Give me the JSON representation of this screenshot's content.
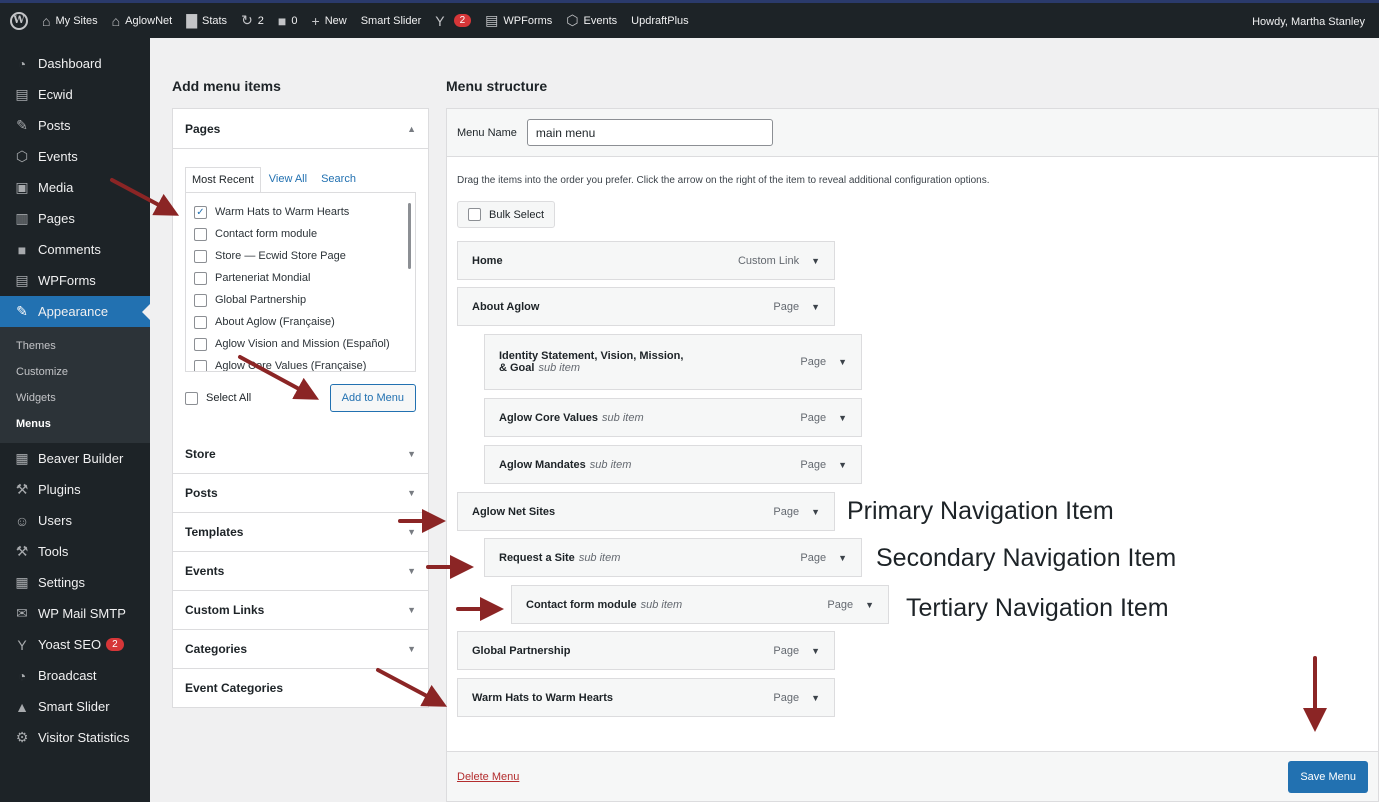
{
  "adminbar": {
    "items": [
      {
        "icon": "home-sites-icon",
        "glyph": "⌂",
        "label": "My Sites"
      },
      {
        "icon": "home-icon",
        "glyph": "⌂",
        "label": "AglowNet"
      },
      {
        "icon": "stats-icon",
        "glyph": "▇",
        "label": "Stats"
      },
      {
        "icon": "updates-icon",
        "glyph": "↻",
        "label": "2"
      },
      {
        "icon": "comment-icon",
        "glyph": "■",
        "label": "0"
      },
      {
        "icon": "plus-icon",
        "glyph": "+",
        "label": "New"
      },
      {
        "icon": "",
        "glyph": "",
        "label": "Smart Slider"
      },
      {
        "icon": "yoast-icon",
        "glyph": "Y",
        "label": ""
      },
      {
        "icon": "wpforms-icon",
        "glyph": "▤",
        "label": "WPForms"
      },
      {
        "icon": "events-icon",
        "glyph": "⬡",
        "label": "Events"
      },
      {
        "icon": "",
        "glyph": "",
        "label": "UpdraftPlus"
      }
    ],
    "yoast_badge": "2",
    "greeting": "Howdy, Martha Stanley"
  },
  "sidebar": {
    "items": [
      {
        "key": "dashboard",
        "label": "Dashboard",
        "glyph": "◔"
      },
      {
        "key": "ecwid",
        "label": "Ecwid",
        "glyph": "▤"
      },
      {
        "key": "posts",
        "label": "Posts",
        "glyph": "✎"
      },
      {
        "key": "events",
        "label": "Events",
        "glyph": "⬡"
      },
      {
        "key": "media",
        "label": "Media",
        "glyph": "▣"
      },
      {
        "key": "pages",
        "label": "Pages",
        "glyph": "▥"
      },
      {
        "key": "comments",
        "label": "Comments",
        "glyph": "■"
      },
      {
        "key": "wpforms",
        "label": "WPForms",
        "glyph": "▤"
      },
      {
        "key": "appearance",
        "label": "Appearance",
        "glyph": "✎"
      }
    ],
    "submenu": [
      "Themes",
      "Customize",
      "Widgets",
      "Menus"
    ],
    "items2": [
      {
        "key": "beaver-builder",
        "label": "Beaver Builder",
        "glyph": "▦"
      },
      {
        "key": "plugins",
        "label": "Plugins",
        "glyph": "⚒"
      },
      {
        "key": "users",
        "label": "Users",
        "glyph": "☺"
      },
      {
        "key": "tools",
        "label": "Tools",
        "glyph": "⚒"
      },
      {
        "key": "settings",
        "label": "Settings",
        "glyph": "▦"
      },
      {
        "key": "wp-mail-smtp",
        "label": "WP Mail SMTP",
        "glyph": "✉"
      },
      {
        "key": "yoast-seo",
        "label": "Yoast SEO",
        "glyph": "Y"
      },
      {
        "key": "broadcast",
        "label": "Broadcast",
        "glyph": "◔"
      },
      {
        "key": "smart-slider",
        "label": "Smart Slider",
        "glyph": "▲"
      },
      {
        "key": "visitor-statistics",
        "label": "Visitor Statistics",
        "glyph": "⚙"
      }
    ],
    "yoast_badge": "2"
  },
  "left": {
    "heading": "Add menu items",
    "pages_title": "Pages",
    "tabs": [
      "Most Recent",
      "View All",
      "Search"
    ],
    "pages": [
      {
        "label": "Warm Hats to Warm Hearts",
        "checked": true
      },
      {
        "label": "Contact form module",
        "checked": false
      },
      {
        "label": "Store — Ecwid Store Page",
        "checked": false
      },
      {
        "label": "Parteneriat Mondial",
        "checked": false
      },
      {
        "label": "Global Partnership",
        "checked": false
      },
      {
        "label": "About Aglow (Française)",
        "checked": false
      },
      {
        "label": "Aglow Vision and Mission (Español)",
        "checked": false
      },
      {
        "label": "Aglow Core Values (Française)",
        "checked": false
      }
    ],
    "select_all": "Select All",
    "add_to_menu": "Add to Menu",
    "sections": [
      "Store",
      "Posts",
      "Templates",
      "Events",
      "Custom Links",
      "Categories",
      "Event Categories"
    ]
  },
  "right": {
    "heading": "Menu structure",
    "menu_name_label": "Menu Name",
    "menu_name_value": "main menu",
    "instructions": "Drag the items into the order you prefer. Click the arrow on the right of the item to reveal additional configuration options.",
    "bulk_select": "Bulk Select",
    "items": [
      {
        "title": "Home",
        "sub": "",
        "type": "Custom Link",
        "depth": 0
      },
      {
        "title": "About Aglow",
        "sub": "",
        "type": "Page",
        "depth": 0
      },
      {
        "title": "Identity Statement, Vision, Mission,",
        "title2": "& Goal",
        "sub": "sub item",
        "type": "Page",
        "depth": 1
      },
      {
        "title": "Aglow Core Values",
        "sub": "sub item",
        "type": "Page",
        "depth": 1
      },
      {
        "title": "Aglow Mandates",
        "sub": "sub item",
        "type": "Page",
        "depth": 1
      },
      {
        "title": "Aglow Net Sites",
        "sub": "",
        "type": "Page",
        "depth": 0
      },
      {
        "title": "Request a Site",
        "sub": "sub item",
        "type": "Page",
        "depth": 1
      },
      {
        "title": "Contact form module",
        "sub": "sub item",
        "type": "Page",
        "depth": 2
      },
      {
        "title": "Global Partnership",
        "sub": "",
        "type": "Page",
        "depth": 0
      },
      {
        "title": "Warm Hats to Warm Hearts",
        "sub": "",
        "type": "Page",
        "depth": 0
      }
    ],
    "delete_menu": "Delete Menu",
    "save_menu": "Save Menu"
  },
  "annotations": {
    "primary": "Primary Navigation Item",
    "secondary": "Secondary Navigation Item",
    "tertiary": "Tertiary Navigation Item",
    "arrow_color": "#8b2525"
  }
}
